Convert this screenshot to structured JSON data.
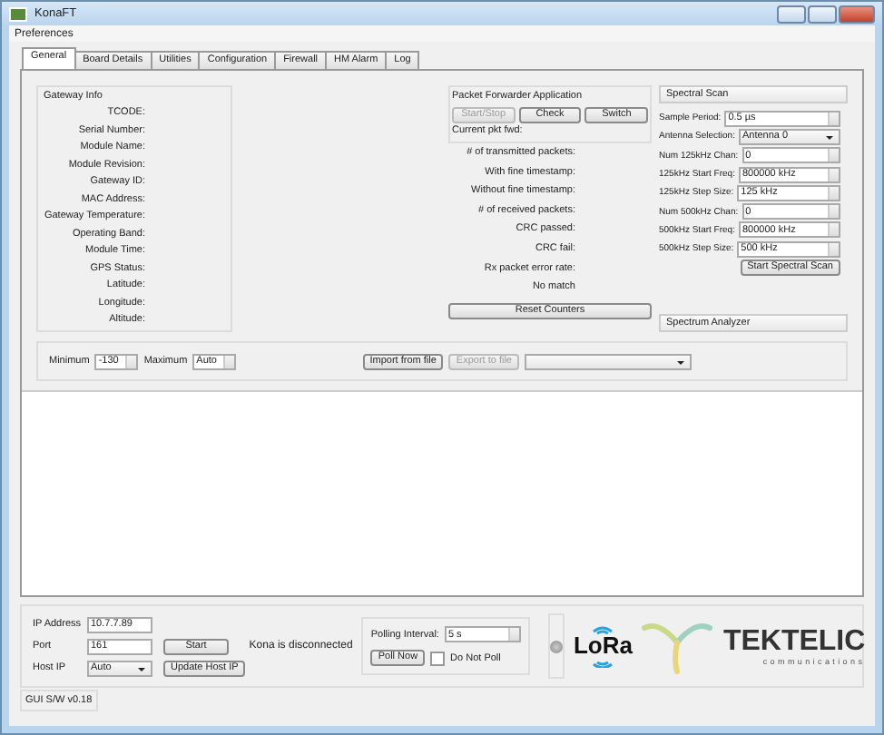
{
  "window": {
    "title": "KonaFT"
  },
  "menu": [
    "Preferences"
  ],
  "tabs": [
    {
      "label": "General",
      "selected": true
    },
    {
      "label": "Board Details",
      "selected": false
    },
    {
      "label": "Utilities",
      "selected": false
    },
    {
      "label": "Configuration",
      "selected": false
    },
    {
      "label": "Firewall",
      "selected": false
    },
    {
      "label": "HM Alarm",
      "selected": false
    },
    {
      "label": "Log",
      "selected": false
    }
  ],
  "gateway_info": {
    "title": "Gateway Info",
    "fields": [
      "TCODE:",
      "Serial Number:",
      "Module Name:",
      "Module Revision:",
      "Gateway ID:",
      "MAC Address:",
      "Gateway Temperature:",
      "Operating Band:",
      "Module Time:",
      "GPS Status:",
      "Latitude:",
      "Longitude:",
      "Altitude:"
    ]
  },
  "packet_forwarder": {
    "title": "Packet Forwarder Application",
    "buttons": [
      {
        "label": "Start/Stop",
        "disabled": true
      },
      {
        "label": "Check",
        "disabled": false
      },
      {
        "label": "Switch",
        "disabled": false
      }
    ],
    "current": "Current pkt fwd:",
    "stats": [
      "# of transmitted packets:",
      "With fine timestamp:",
      "Without fine timestamp:",
      "# of received packets:",
      "CRC passed:",
      "CRC fail:",
      "Rx packet error rate:",
      "No match"
    ],
    "reset": "Reset Counters"
  },
  "spectral_scan": {
    "title": "Spectral Scan",
    "rows": [
      {
        "kind": "spin",
        "label": "Sample Period:",
        "value": "0.5 µs"
      },
      {
        "kind": "dropdown",
        "label": "Antenna Selection:",
        "value": "Antenna 0"
      },
      {
        "kind": "spin",
        "label": "Num 125kHz Chan:",
        "value": "0"
      },
      {
        "kind": "spin",
        "label": "125kHz Start Freq:",
        "value": "800000 kHz"
      },
      {
        "kind": "spin",
        "label": "125kHz Step Size:",
        "value": "125 kHz"
      },
      {
        "kind": "spin",
        "label": "Num 500kHz Chan:",
        "value": "0"
      },
      {
        "kind": "spin",
        "label": "500kHz Start Freq:",
        "value": "800000 kHz"
      },
      {
        "kind": "spin",
        "label": "500kHz Step Size:",
        "value": "500 kHz"
      }
    ],
    "button": "Start Spectral Scan"
  },
  "spectrum_analyzer": {
    "title": "Spectrum Analyzer"
  },
  "plot_controls": {
    "minimum_label": "Minimum",
    "minimum": "-130",
    "maximum_label": "Maximum",
    "maximum": "Auto",
    "buttons": [
      {
        "label": "Import from file",
        "disabled": false
      },
      {
        "label": "Export to file",
        "disabled": true
      }
    ]
  },
  "connection": {
    "ip_label": "IP Address",
    "ip": "10.7.7.89",
    "port_label": "Port",
    "port": "161",
    "start": "Start",
    "status": "Kona is disconnected",
    "host_label": "Host IP",
    "host": "Auto",
    "update": "Update Host IP"
  },
  "polling": {
    "label": "Polling Interval:",
    "value": "5 s",
    "poll_now": "Poll Now",
    "do_not_poll": {
      "label": "Do Not Poll",
      "checked": false
    }
  },
  "logos": {
    "lora": "LoRa",
    "tektelic": "TEKTELIC",
    "tagline": "communications"
  },
  "status_bar": "GUI S/W v0.18"
}
